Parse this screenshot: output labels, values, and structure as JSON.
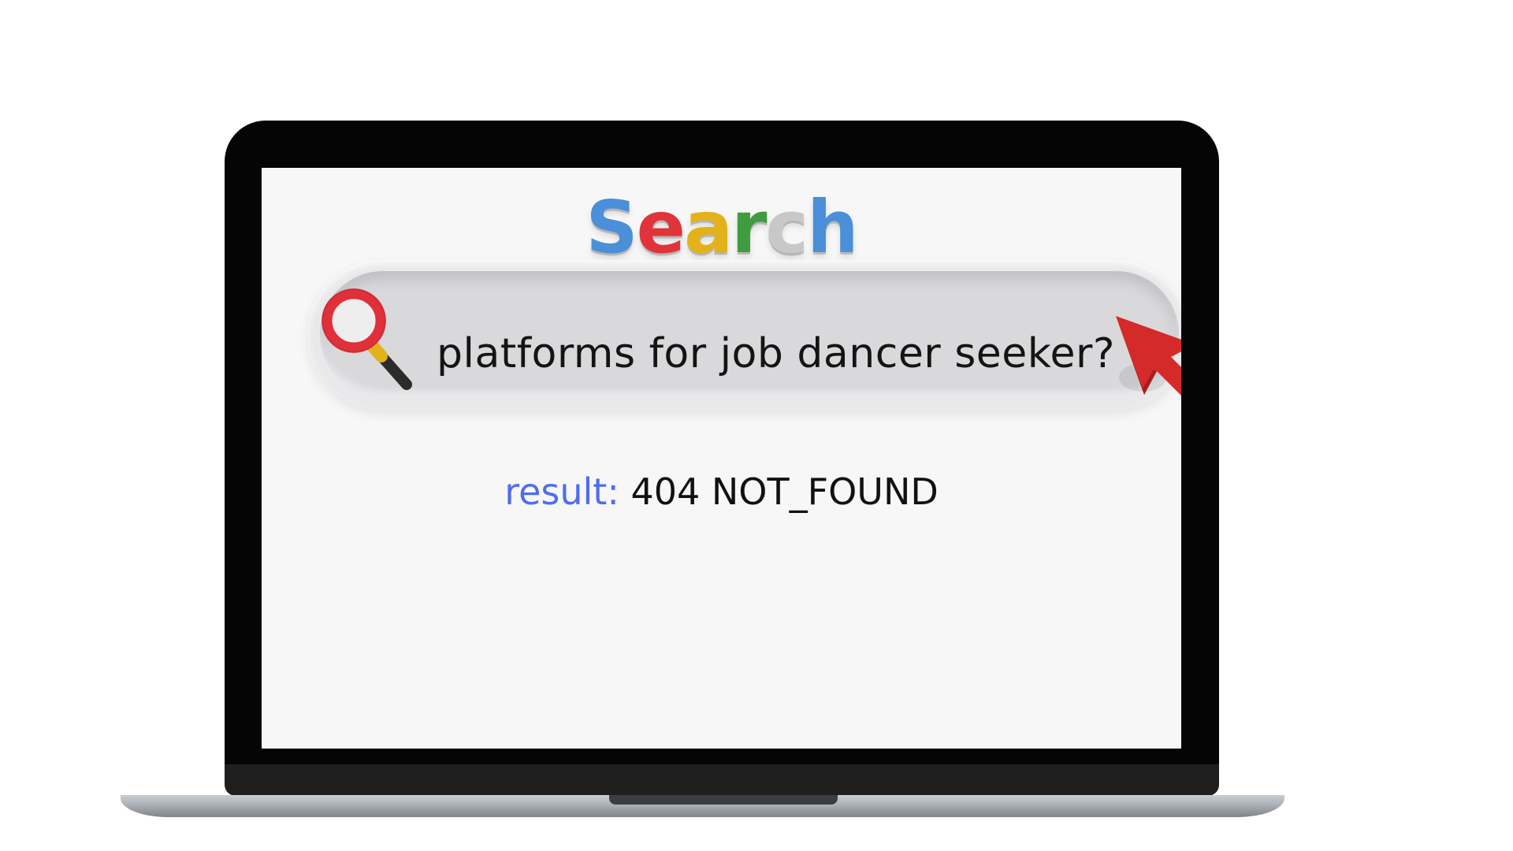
{
  "logo": {
    "letters": [
      {
        "char": "S",
        "color": "#4a8fd8"
      },
      {
        "char": "e",
        "color": "#e0343a"
      },
      {
        "char": "a",
        "color": "#e3b21a"
      },
      {
        "char": "r",
        "color": "#3f9c3f"
      },
      {
        "char": "c",
        "color": "#c8c8c8"
      },
      {
        "char": "h",
        "color": "#4a8fd8"
      }
    ]
  },
  "search": {
    "query": "platforms for job dancer seeker?",
    "icon": "search-icon"
  },
  "cursor": {
    "icon": "pointer-arrow-icon",
    "color": "#d42a2a"
  },
  "result": {
    "label": "result:",
    "value": "404 NOT_FOUND",
    "label_color": "#4f6cf0"
  }
}
